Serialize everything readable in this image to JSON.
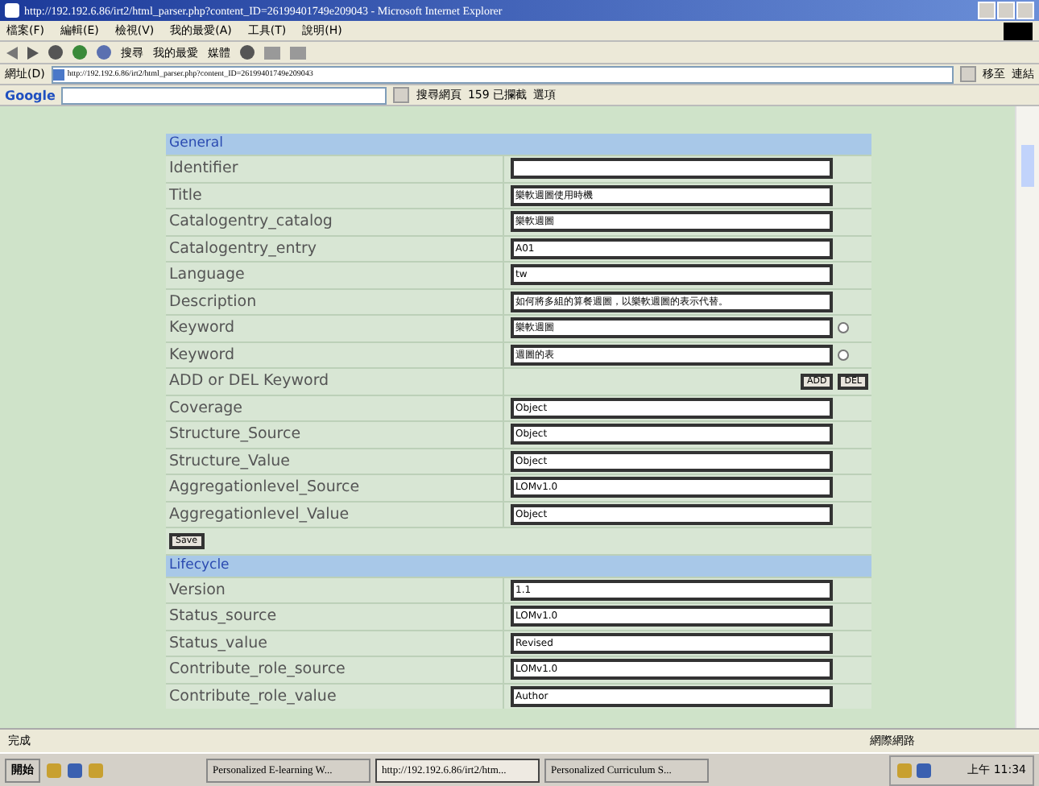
{
  "window": {
    "title": "http://192.192.6.86/irt2/html_parser.php?content_ID=26199401749e209043 - Microsoft Internet Explorer"
  },
  "menu": [
    "檔案(F)",
    "編輯(E)",
    "檢視(V)",
    "我的最愛(A)",
    "工具(T)",
    "說明(H)"
  ],
  "toolbar": {
    "search": "搜尋",
    "favorites": "我的最愛",
    "media": "媒體"
  },
  "address": {
    "label": "網址(D)",
    "value": "http://192.192.6.86/irt2/html_parser.php?content_ID=26199401749e209043",
    "go": "移至",
    "links": "連結"
  },
  "google": {
    "label": "Google",
    "search": "搜尋網頁",
    "blocked": "159 已攔截",
    "options": "選項"
  },
  "rows": [
    {
      "kind": "section",
      "label": "General"
    },
    {
      "kind": "field",
      "label": "Identifier",
      "value": ""
    },
    {
      "kind": "field",
      "label": "Title",
      "value": "樂軟週圖使用時機"
    },
    {
      "kind": "field",
      "label": "Catalogentry_catalog",
      "value": "樂軟週圖"
    },
    {
      "kind": "field",
      "label": "Catalogentry_entry",
      "value": "A01"
    },
    {
      "kind": "field",
      "label": "Language",
      "value": "tw"
    },
    {
      "kind": "field",
      "label": "Description",
      "value": "如何將多組的算餐週圖，以樂軟週圖的表示代替。"
    },
    {
      "kind": "radio",
      "label": "Keyword",
      "value": "樂軟週圖",
      "selected": false
    },
    {
      "kind": "radio",
      "label": "Keyword",
      "value": "週圖的表",
      "selected": false
    },
    {
      "kind": "buttons",
      "label": "ADD or DEL Keyword",
      "buttons": [
        "ADD",
        "DEL"
      ]
    },
    {
      "kind": "field",
      "label": "Coverage",
      "value": "Object"
    },
    {
      "kind": "field",
      "label": "Structure_Source",
      "value": "Object"
    },
    {
      "kind": "field",
      "label": "Structure_Value",
      "value": "Object"
    },
    {
      "kind": "field",
      "label": "Aggregationlevel_Source",
      "value": "LOMv1.0"
    },
    {
      "kind": "field",
      "label": "Aggregationlevel_Value",
      "value": "Object"
    },
    {
      "kind": "save",
      "label": "Save"
    },
    {
      "kind": "section",
      "label": "Lifecycle"
    },
    {
      "kind": "field",
      "label": "Version",
      "value": "1.1"
    },
    {
      "kind": "field",
      "label": "Status_source",
      "value": "LOMv1.0"
    },
    {
      "kind": "field",
      "label": "Status_value",
      "value": "Revised"
    },
    {
      "kind": "field",
      "label": "Contribute_role_source",
      "value": "LOMv1.0"
    },
    {
      "kind": "field",
      "label": "Contribute_role_value",
      "value": "Author"
    }
  ],
  "status_bar": {
    "text": "完成",
    "zone": "網際網路"
  },
  "taskbar": {
    "start": "開始",
    "tasks": [
      {
        "label": "Personalized E-learning W...",
        "selected": false
      },
      {
        "label": "http://192.192.6.86/irt2/htm...",
        "selected": true
      },
      {
        "label": "Personalized Curriculum S...",
        "selected": false
      }
    ],
    "clock": "上午 11:34"
  }
}
